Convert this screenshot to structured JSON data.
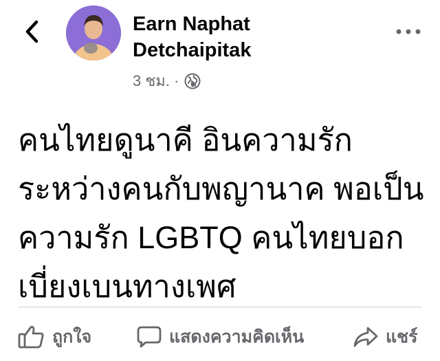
{
  "header": {
    "back_icon": "chevron-left-icon",
    "author_name": "Earn Naphat\nDetchaipitak",
    "timestamp": "3 ชม. ·",
    "privacy_icon": "globe-icon",
    "more_icon": "more-horizontal-icon"
  },
  "post": {
    "text": "คนไทยดูนาคี อินความรัก\nระหว่างคนกับพญานาค พอเป็น\nความรัก LGBTQ คนไทยบอก\nเบี่ยงเบนทางเพศ"
  },
  "actions": [
    {
      "label": "ถูกใจ",
      "icon": "like-icon"
    },
    {
      "label": "แสดงความคิดเห็น",
      "icon": "comment-icon"
    },
    {
      "label": "แชร์",
      "icon": "share-icon"
    }
  ],
  "colors": {
    "text": "#050505",
    "secondary": "#65676b",
    "divider": "#ced0d4",
    "avatar_bg": "#8c6ed6"
  }
}
